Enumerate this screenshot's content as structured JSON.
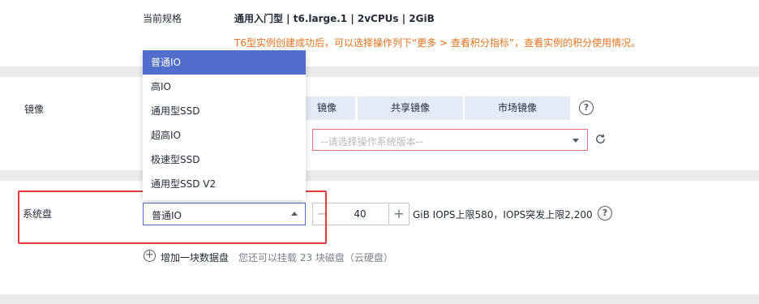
{
  "spec": {
    "label": "当前规格",
    "value": "通用入门型 | t6.large.1 | 2vCPUs | 2GiB",
    "note": "T6型实例创建成功后，可以选择操作列下“更多 > 查看积分指标”，查看实例的积分使用情况。"
  },
  "image": {
    "label": "镜像",
    "tabs": [
      "镜像",
      "共享镜像",
      "市场镜像"
    ],
    "os_select_placeholder": "--请选择操作系统版本--"
  },
  "disk": {
    "label": "系统盘",
    "type_value": "普通IO",
    "size_value": "40",
    "minus": "−",
    "plus": "+",
    "limits_text": "GiB IOPS上限580，IOPS突发上限2,200",
    "add_disk_label": "增加一块数据盘",
    "add_disk_note": "您还可以挂载 23 块磁盘（云硬盘）"
  },
  "dropdown": {
    "options": [
      "普通IO",
      "高IO",
      "通用型SSD",
      "超高IO",
      "极速型SSD",
      "通用型SSD V2"
    ],
    "selected_index": 0
  },
  "colors": {
    "accent": "#526ecc",
    "warning": "#e8731d",
    "error_border": "#e0707a",
    "highlight": "#e23d3d"
  }
}
